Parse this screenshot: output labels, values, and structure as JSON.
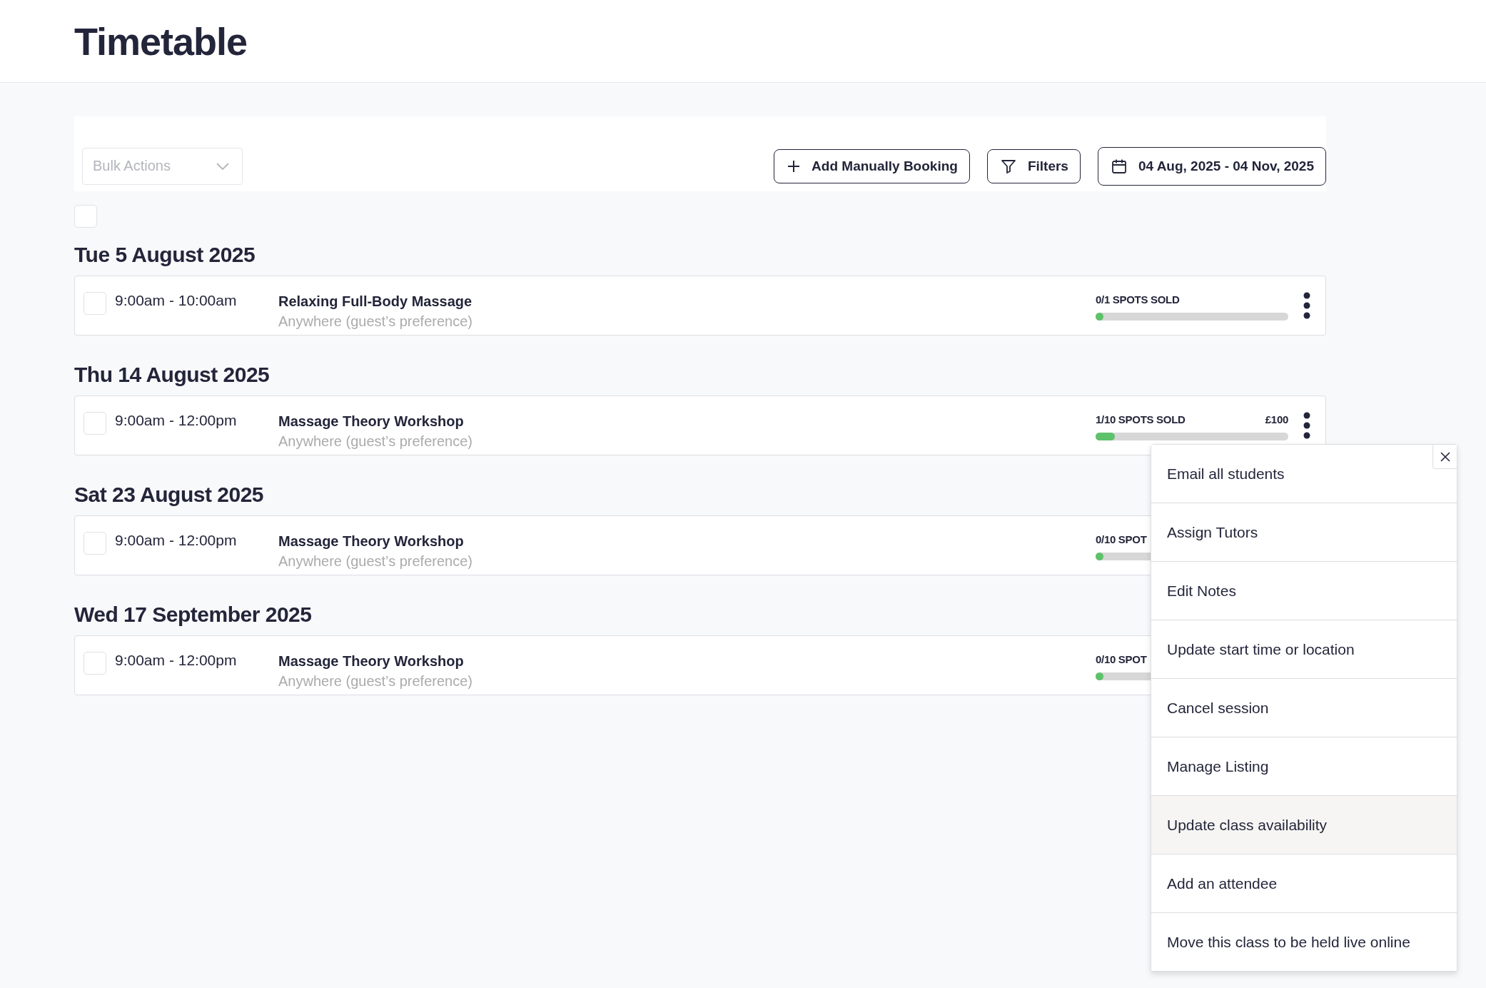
{
  "page": {
    "title": "Timetable"
  },
  "toolbar": {
    "bulk_actions": {
      "placeholder": "Bulk Actions"
    },
    "buttons": [
      {
        "kind": "add",
        "label": "Add Manually Booking"
      },
      {
        "kind": "filter",
        "label": "Filters"
      },
      {
        "kind": "date",
        "label": "04 Aug, 2025 - 04 Nov, 2025"
      }
    ]
  },
  "select_all": {
    "checked": false
  },
  "days": [
    {
      "heading": "Tue 5 August 2025",
      "sessions": [
        {
          "checked": false,
          "time": "9:00am - 10:00am",
          "title": "Relaxing Full-Body Massage",
          "location": "Anywhere (guest’s preference)",
          "spots": "0/1 SPOTS SOLD",
          "level": 0
        }
      ]
    },
    {
      "heading": "Thu 14 August 2025",
      "sessions": [
        {
          "checked": false,
          "time": "9:00am - 12:00pm",
          "title": "Massage Theory Workshop",
          "location": "Anywhere (guest’s preference)",
          "spots": "1/10 SPOTS SOLD",
          "price": "£100",
          "level": 0.1
        }
      ]
    },
    {
      "heading": "Sat 23 August 2025",
      "sessions": [
        {
          "checked": false,
          "time": "9:00am - 12:00pm",
          "title": "Massage Theory Workshop",
          "location": "Anywhere (guest’s preference)",
          "spots": "0/10 SPOT",
          "level": 0
        }
      ]
    },
    {
      "heading": "Wed 17 September 2025",
      "sessions": [
        {
          "checked": false,
          "time": "9:00am - 12:00pm",
          "title": "Massage Theory Workshop",
          "location": "Anywhere (guest’s preference)",
          "spots": "0/10 SPOT",
          "level": 0
        }
      ]
    }
  ],
  "menu": {
    "items": [
      {
        "label": "Email all students",
        "selected": false
      },
      {
        "label": "Assign Tutors",
        "selected": false
      },
      {
        "label": "Edit Notes",
        "selected": false
      },
      {
        "label": "Update start time or location",
        "selected": false
      },
      {
        "label": "Cancel session",
        "selected": false
      },
      {
        "label": "Manage Listing",
        "selected": false
      },
      {
        "label": "Update class availability",
        "selected": true
      },
      {
        "label": "Add an attendee",
        "selected": false
      },
      {
        "label": "Move this class to be held live online",
        "selected": false
      }
    ]
  }
}
